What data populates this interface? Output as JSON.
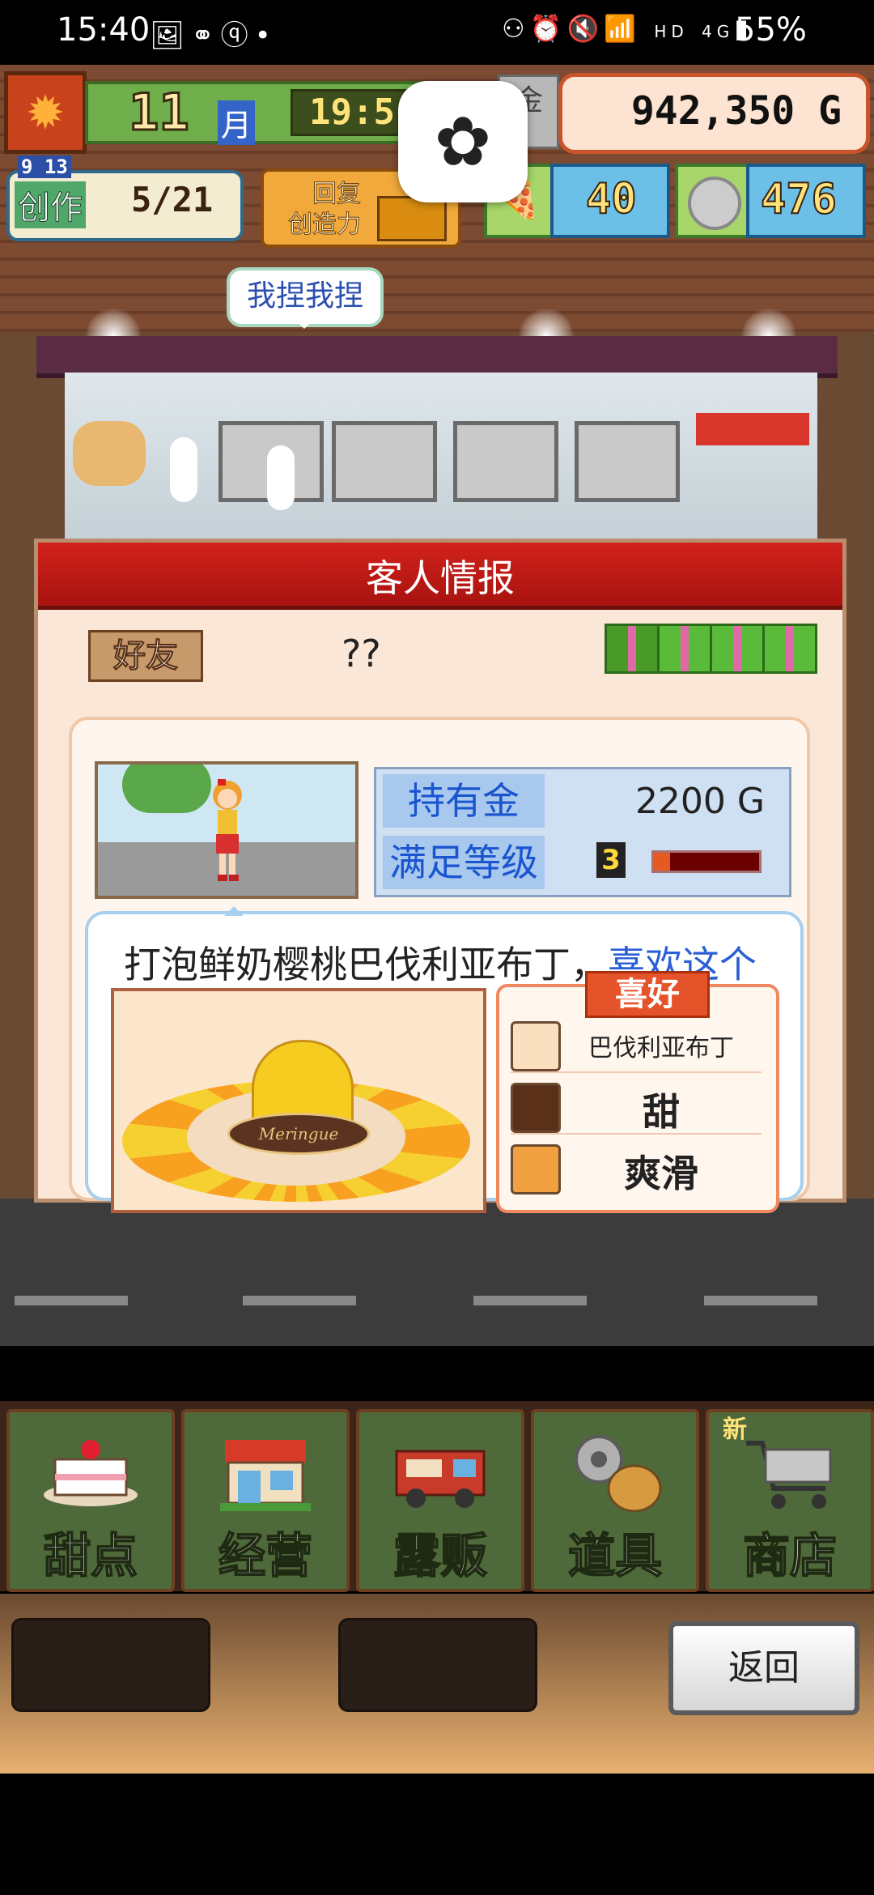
{
  "status_bar": {
    "time": "15:40",
    "left_icons": [
      "gallery-icon",
      "link-icon",
      "q-icon",
      "dot-icon"
    ],
    "right_icons": [
      "cast-icon",
      "alarm-icon",
      "mute-icon",
      "wifi-icon",
      "signal-icon"
    ],
    "network": "HD",
    "network_gen": "4G",
    "battery": "55%"
  },
  "hud": {
    "month_number": "11",
    "month_unit": "月",
    "clock": "19:5",
    "money": "942,350 G",
    "gold_tag": "金",
    "create_mini": "9 13",
    "create_label": "创作",
    "create_count": "5/21",
    "restore_line1": "回复",
    "restore_line2": "创造力",
    "points_value": "40",
    "silver_value": "476",
    "flower_icon": "✿"
  },
  "scene": {
    "bubble_text": "我捏我捏"
  },
  "customer_panel": {
    "title": "客人情报",
    "friend_badge": "好友",
    "name": "??",
    "gifts_count": 4,
    "money_label": "持有金",
    "money_value": "2200 G",
    "satisfaction_label": "满足等级",
    "satisfaction_level": "3",
    "satisfaction_fill": 0.15,
    "speech_dish": "打泡鲜奶樱桃巴伐利亚布丁，",
    "speech_like": "喜欢这个",
    "dish_plaque": "Meringue",
    "prefs_title": "喜好",
    "prefs": [
      {
        "icon": "pudding-icon",
        "text": "巴伐利亚布丁"
      },
      {
        "icon": "chocolate-icon",
        "text": "甜"
      },
      {
        "icon": "bread-icon",
        "text": "爽滑"
      }
    ]
  },
  "menu": {
    "items": [
      {
        "label": "甜点",
        "icon": "cake-icon"
      },
      {
        "label": "经营",
        "icon": "shop-icon"
      },
      {
        "label": "露贩",
        "icon": "truck-icon"
      },
      {
        "label": "道具",
        "icon": "gear-bag-icon"
      },
      {
        "label": "商店",
        "icon": "cart-icon"
      }
    ],
    "new_tag": "新"
  },
  "back_label": "返回"
}
